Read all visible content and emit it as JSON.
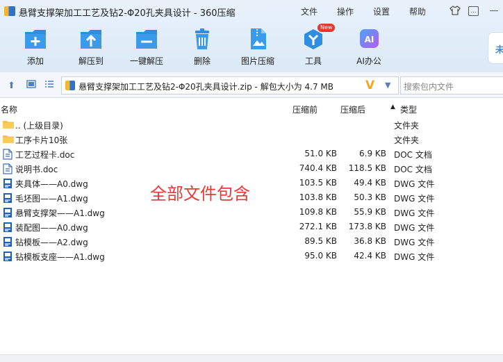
{
  "window": {
    "title": "悬臂支撑架加工工艺及钻2-Φ20孔夹具设计 - 360压缩",
    "menus": [
      "文件",
      "操作",
      "设置",
      "帮助"
    ]
  },
  "toolbar": {
    "add": "添加",
    "extract_to": "解压到",
    "one_click_extract": "一键解压",
    "delete": "删除",
    "image_compress": "图片压缩",
    "tools": "工具",
    "tools_badge": "New",
    "ai_office": "AI办公",
    "ai_icon_text": "AI",
    "side_badge": "未"
  },
  "address": {
    "path": "悬臂支撑架加工工艺及钻2-Φ20孔夹具设计.zip - 解包大小为 4.7 MB",
    "search_placeholder": "搜索包内文件"
  },
  "columns": {
    "name": "名称",
    "size": "压缩前",
    "compressed": "压缩后",
    "type": "类型",
    "sort_indicator": "▲"
  },
  "files": [
    {
      "icon": "folder-icon",
      "name": ".. (上级目录)",
      "size": "",
      "compressed": "",
      "type": "文件夹"
    },
    {
      "icon": "folder-icon",
      "name": "工序卡片10张",
      "size": "",
      "compressed": "",
      "type": "文件夹"
    },
    {
      "icon": "doc-icon",
      "name": "工艺过程卡.doc",
      "size": "51.0 KB",
      "compressed": "6.9 KB",
      "type": "DOC 文档"
    },
    {
      "icon": "doc-icon",
      "name": "说明书.doc",
      "size": "740.4 KB",
      "compressed": "118.5 KB",
      "type": "DOC 文档"
    },
    {
      "icon": "dwg-icon",
      "name": "夹具体——A0.dwg",
      "size": "103.5 KB",
      "compressed": "49.4 KB",
      "type": "DWG 文件"
    },
    {
      "icon": "dwg-icon",
      "name": "毛坯图——A1.dwg",
      "size": "103.8 KB",
      "compressed": "50.3 KB",
      "type": "DWG 文件"
    },
    {
      "icon": "dwg-icon",
      "name": "悬臂支撑架——A1.dwg",
      "size": "109.8 KB",
      "compressed": "55.9 KB",
      "type": "DWG 文件"
    },
    {
      "icon": "dwg-icon",
      "name": "装配图——A0.dwg",
      "size": "272.1 KB",
      "compressed": "173.8 KB",
      "type": "DWG 文件"
    },
    {
      "icon": "dwg-icon",
      "name": "钻模板——A2.dwg",
      "size": "89.5 KB",
      "compressed": "36.8 KB",
      "type": "DWG 文件"
    },
    {
      "icon": "dwg-icon",
      "name": "钻模板支座——A1.dwg",
      "size": "95.0 KB",
      "compressed": "42.4 KB",
      "type": "DWG 文件"
    }
  ],
  "overlay_text": "全部文件包含",
  "colors": {
    "accent": "#2f8ee0",
    "overlay": "#e53935",
    "folder": "#f5c342"
  }
}
